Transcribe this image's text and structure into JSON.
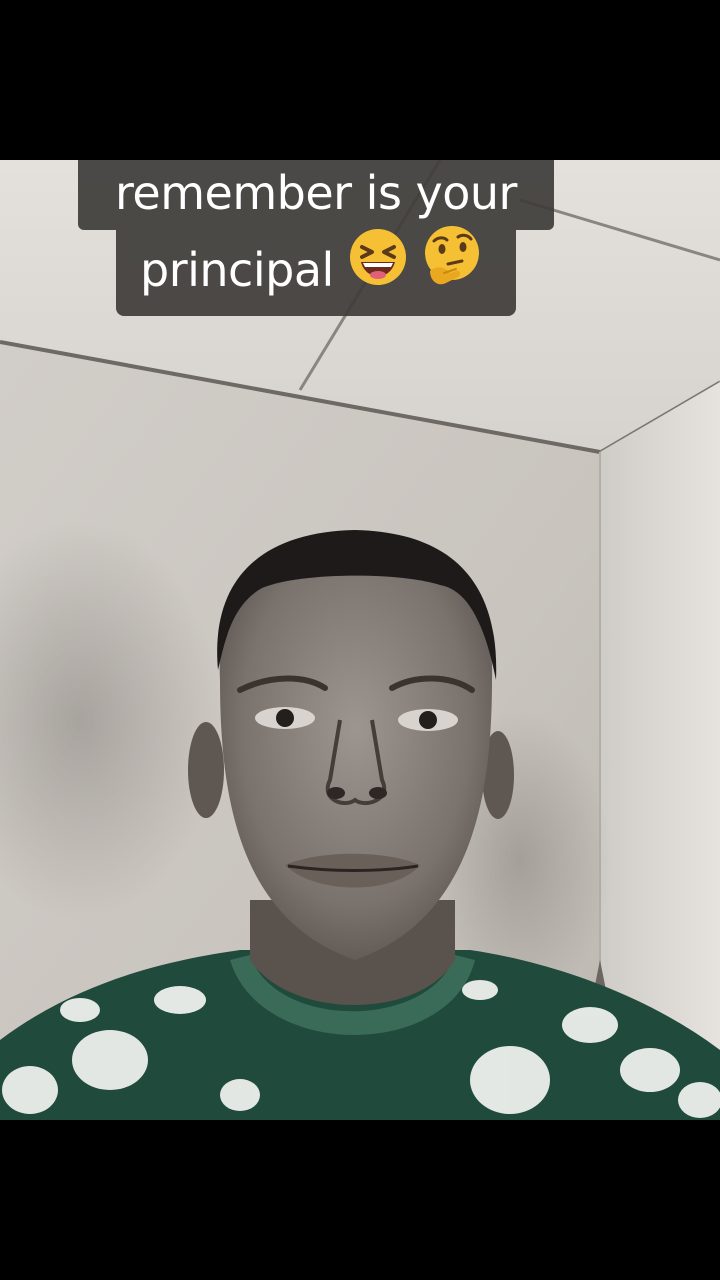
{
  "caption": {
    "line1": "remember is your",
    "line2": "principal",
    "emoji_1": "grinning-squinting-face-emoji",
    "emoji_2": "thinking-face-emoji"
  },
  "colors": {
    "letterbox": "#000000",
    "caption_background": "#3e3c3a",
    "caption_text": "#ffffff",
    "wall": "#d8d4cf",
    "shirt_green": "#1f4a3c"
  }
}
